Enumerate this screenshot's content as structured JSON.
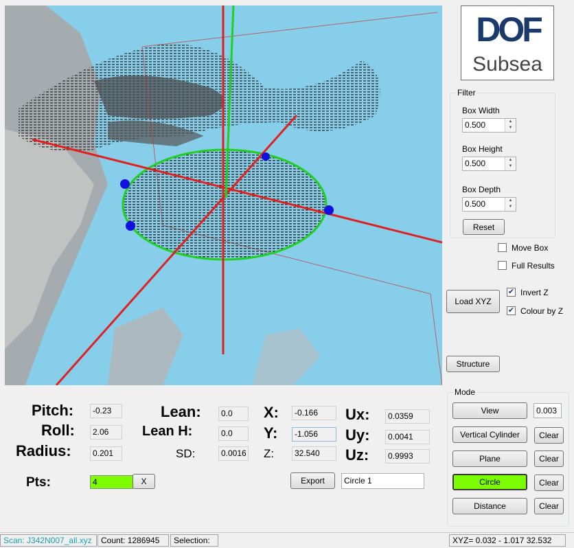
{
  "logo": {
    "line1": "DOF",
    "line2": "Subsea"
  },
  "filter": {
    "title": "Filter",
    "box_width_label": "Box Width",
    "box_width": "0.500",
    "box_height_label": "Box Height",
    "box_height": "0.500",
    "box_depth_label": "Box Depth",
    "box_depth": "0.500",
    "reset_label": "Reset"
  },
  "options": {
    "move_box": "Move Box",
    "move_box_checked": false,
    "full_results": "Full Results",
    "full_results_checked": false,
    "invert_z": "Invert Z",
    "invert_z_checked": true,
    "colour_by_z": "Colour by Z",
    "colour_by_z_checked": true,
    "load_xyz": "Load XYZ",
    "structure": "Structure"
  },
  "mode": {
    "title": "Mode",
    "view": "View",
    "view_value": "0.003",
    "vertical_cylinder": "Vertical Cylinder",
    "plane": "Plane",
    "circle": "Circle",
    "distance": "Distance",
    "clear": "Clear",
    "active": "Circle",
    "active_color": "#7cfc00"
  },
  "results": {
    "pitch_label": "Pitch:",
    "pitch": "-0.23",
    "roll_label": "Roll:",
    "roll": "2.06",
    "radius_label": "Radius:",
    "radius": "0.201",
    "lean_label": "Lean:",
    "lean": "0.0",
    "lean_h_label": "Lean H:",
    "lean_h": "0.0",
    "sd_label": "SD:",
    "sd": "0.0016",
    "x_label": "X:",
    "x": "-0.166",
    "y_label": "Y:",
    "y": "-1.056",
    "z_label": "Z:",
    "z": "32.540",
    "ux_label": "Ux:",
    "ux": "0.0359",
    "uy_label": "Uy:",
    "uy": "0.0041",
    "uz_label": "Uz:",
    "uz": "0.9993",
    "pts_label": "Pts:",
    "pts": "4",
    "pts_clear": "X",
    "export": "Export",
    "name": "Circle 1"
  },
  "status": {
    "scan": "Scan: J342N007_all.xyz",
    "count": "Count: 1286945",
    "selection": "Selection:",
    "xyz": "XYZ= 0.032 - 1.017  32.532"
  },
  "colors": {
    "viewport_bg": "#87ceeb",
    "axis_red": "#e0201e",
    "axis_green": "#20d020",
    "marker_blue": "#1010e0",
    "brand_blue": "#1b3a6b"
  }
}
